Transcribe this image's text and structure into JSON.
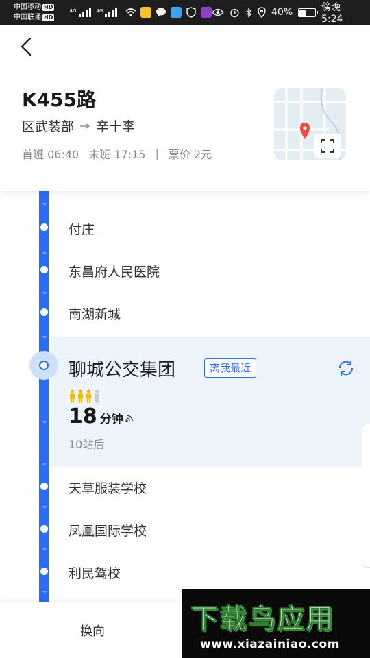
{
  "status_bar": {
    "carrier1": "中国移动",
    "carrier2": "中国联通",
    "hd": "HD",
    "net1": "4G",
    "net2": "4G",
    "battery": "40%",
    "time": "傍晚5:24"
  },
  "header": {
    "route_name": "K455路",
    "from": "区武装部",
    "to": "辛十李",
    "first_bus_label": "首班",
    "first_bus": "06:40",
    "last_bus_label": "末班",
    "last_bus": "17:15",
    "separator": "|",
    "fare_label": "票价",
    "fare": "2元"
  },
  "stops": [
    {
      "name": "付庄"
    },
    {
      "name": "东昌府人民医院"
    },
    {
      "name": "南湖新城"
    },
    {
      "name": "天草服装学校"
    },
    {
      "name": "凤凰国际学校"
    },
    {
      "name": "利民驾校"
    }
  ],
  "current_stop": {
    "name": "聊城公交集团",
    "badge": "离我最近",
    "eta_value": "18",
    "eta_unit": "分钟",
    "stops_away": "10站后",
    "crowd_level": 3,
    "crowd_max": 4
  },
  "bottom_bar": {
    "reverse_label": "换向"
  },
  "watermark": {
    "title": "下载鸟应用",
    "url": "www.xiazainiao.com"
  },
  "colors": {
    "accent": "#2b6cf6",
    "current_bg": "#eef4fc",
    "crowd_filled": "#f5b800",
    "crowd_empty": "#c9c9c9",
    "map_pin": "#ef4b3f"
  }
}
